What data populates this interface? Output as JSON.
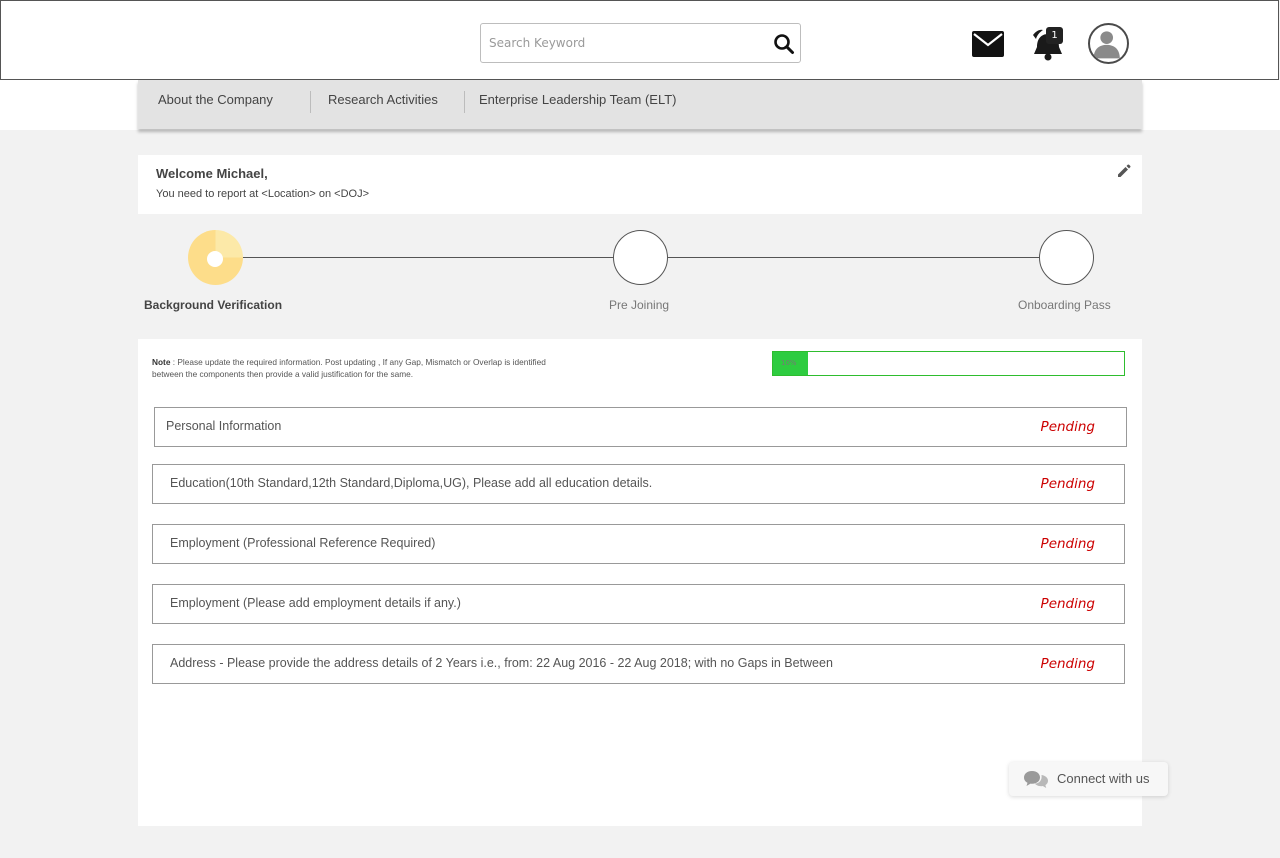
{
  "header": {
    "search": {
      "placeholder": "Search Keyword",
      "icon": "search-icon"
    },
    "notifications": {
      "count": "1"
    },
    "icons": [
      "mail-icon",
      "notification-icon",
      "user-avatar-icon"
    ]
  },
  "nav": {
    "items": [
      {
        "label": "About the Company"
      },
      {
        "label": "Research Activities"
      },
      {
        "label": "Enterprise Leadership Team (ELT)"
      }
    ]
  },
  "welcome": {
    "title": "Welcome Michael,",
    "subtitle": "You need to report at <Location> on <DOJ>",
    "edit_icon": "pencil-icon"
  },
  "stepper": {
    "steps": [
      {
        "label": "Background Verification",
        "state": "active"
      },
      {
        "label": "Pre Joining",
        "state": "inactive"
      },
      {
        "label": "Onboarding Pass",
        "state": "inactive"
      }
    ]
  },
  "bgv": {
    "note_label": "Note",
    "note_text": " : Please update the required information. Post updating , If any Gap, Mismatch or Overlap is identified between the components then provide a valid justification for the same.",
    "progress": {
      "percent_complete": 10,
      "label": "10%"
    },
    "sections": [
      {
        "label": "Personal Information",
        "status": "Pending"
      },
      {
        "label": "Education(10th Standard,12th Standard,Diploma,UG), Please add all education details.",
        "status": "Pending"
      },
      {
        "label": "Employment (Professional Reference Required)",
        "status": "Pending"
      },
      {
        "label": "Employment (Please add employment details if any.)",
        "status": "Pending"
      },
      {
        "label": "Address - Please provide the address details of 2 Years i.e., from: 22 Aug 2016 - 22 Aug 2018; with no Gaps in Between",
        "status": "Pending"
      }
    ],
    "status_color": "#cc0000"
  },
  "connect": {
    "label": "Connect with us",
    "icon": "chat-icon"
  }
}
